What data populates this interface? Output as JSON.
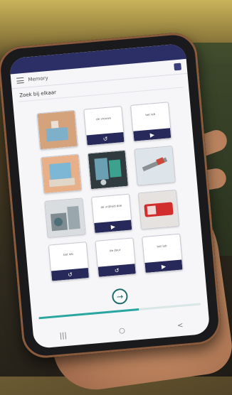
{
  "app": {
    "title": "Memory",
    "instruction": "Zoek bij elkaar"
  },
  "cards": [
    {
      "kind": "photo",
      "photo": "photo-blue-object"
    },
    {
      "kind": "audio",
      "label": "de vrouwe",
      "control": "↺"
    },
    {
      "kind": "audio",
      "label": "bet leb",
      "control": "▶"
    },
    {
      "kind": "photo",
      "photo": "photo-machine"
    },
    {
      "kind": "photo",
      "photo": "photo-machine-2"
    },
    {
      "kind": "photo",
      "photo": "photo-tool"
    },
    {
      "kind": "photo",
      "photo": "photo-machine-3"
    },
    {
      "kind": "audio",
      "label": "de vrijheid doe",
      "control": "▶"
    },
    {
      "kind": "photo",
      "photo": "photo-red-object"
    },
    {
      "kind": "audio",
      "label": "bet leb",
      "control": "↺"
    },
    {
      "kind": "audio",
      "label": "de deur",
      "control": "↺"
    },
    {
      "kind": "audio",
      "label": "bet leb",
      "control": "▶"
    }
  ],
  "progress": {
    "value": 0.62
  },
  "icons": {
    "menu": "menu-icon",
    "settings": "settings-icon",
    "next": "arrow-right-icon"
  },
  "colors": {
    "accent": "#2aa6a1",
    "card_control": "#26295a",
    "statusbar": "#2b2f66"
  }
}
